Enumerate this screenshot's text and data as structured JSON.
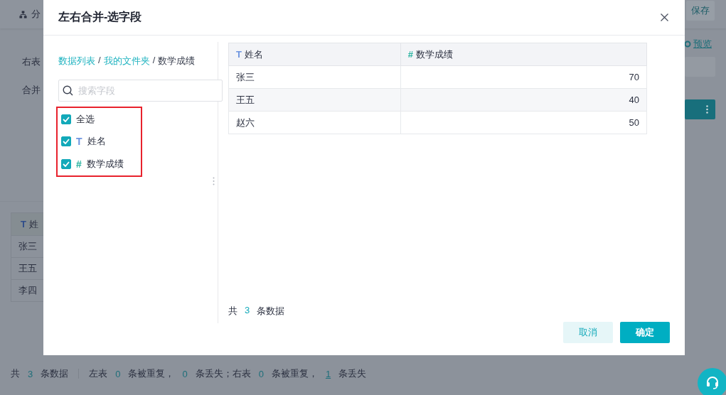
{
  "background": {
    "toolbar": {
      "tab_label": "分",
      "save_button": "保存"
    },
    "preview_link": "预览",
    "form_labels": [
      "右表",
      "合并"
    ],
    "table": {
      "header": {
        "type_glyph": "T",
        "name": "姓"
      },
      "rows": [
        "张三",
        "王五",
        "李四"
      ]
    },
    "status_bar": [
      {
        "kind": "text",
        "text": "共"
      },
      {
        "kind": "number",
        "text": "3"
      },
      {
        "kind": "text",
        "text": "条数据"
      },
      {
        "kind": "divider"
      },
      {
        "kind": "text",
        "text": "左表"
      },
      {
        "kind": "number",
        "text": "0"
      },
      {
        "kind": "text",
        "text": "条被重复，"
      },
      {
        "kind": "number",
        "text": "0"
      },
      {
        "kind": "text",
        "text": "条丢失；右表"
      },
      {
        "kind": "number",
        "text": "0"
      },
      {
        "kind": "text",
        "text": "条被重复，"
      },
      {
        "kind": "link",
        "text": "1"
      },
      {
        "kind": "text",
        "text": "条丢失"
      }
    ]
  },
  "dialog": {
    "title": "左右合并-选字段",
    "breadcrumb": [
      {
        "kind": "link",
        "text": "数据列表"
      },
      {
        "kind": "separator",
        "text": "/"
      },
      {
        "kind": "link",
        "text": "我的文件夹"
      },
      {
        "kind": "separator",
        "text": "/"
      },
      {
        "kind": "current",
        "text": "数学成绩"
      }
    ],
    "search": {
      "placeholder": "搜索字段"
    },
    "field_list": {
      "highlighted": true,
      "items": [
        {
          "kind": "all",
          "label": "全选",
          "checked": true
        },
        {
          "kind": "text",
          "type_glyph": "T",
          "label": "姓名",
          "checked": true
        },
        {
          "kind": "number",
          "type_glyph": "#",
          "label": "数学成绩",
          "checked": true
        }
      ]
    },
    "table": {
      "columns": [
        {
          "kind": "text",
          "type_glyph": "T",
          "name": "姓名"
        },
        {
          "kind": "number",
          "type_glyph": "#",
          "name": "数学成绩"
        }
      ],
      "rows": [
        [
          "张三",
          "70"
        ],
        [
          "王五",
          "40"
        ],
        [
          "赵六",
          "50"
        ]
      ]
    },
    "count": {
      "prefix": "共",
      "value": "3",
      "suffix": "条数据"
    },
    "buttons": [
      {
        "kind": "secondary",
        "label": "取消"
      },
      {
        "kind": "primary",
        "label": "确定"
      }
    ]
  }
}
